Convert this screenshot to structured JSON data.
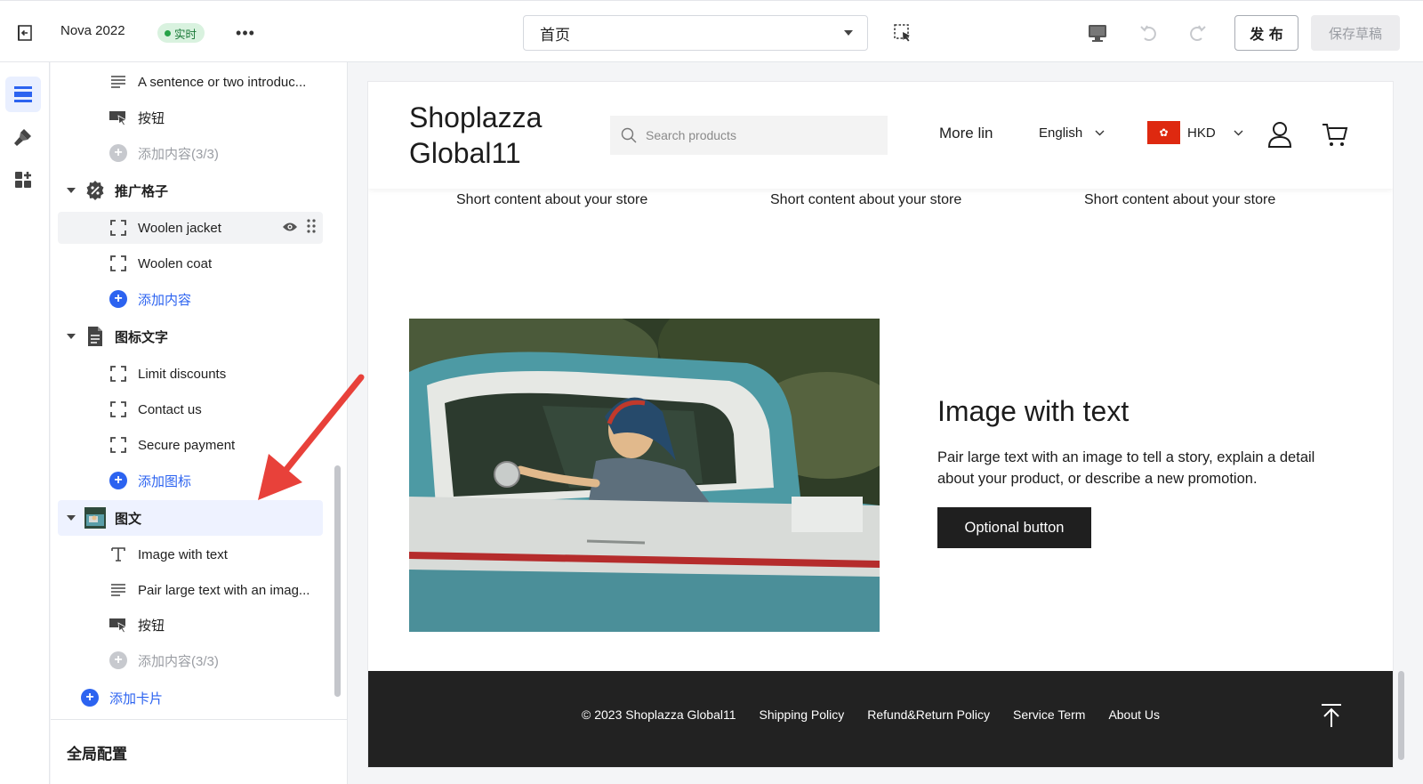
{
  "topbar": {
    "theme_name": "Nova 2022",
    "live_badge": "实时",
    "page_select": "首页",
    "publish": "发 布",
    "save_draft": "保存草稿"
  },
  "rail": {
    "items": [
      "sections-icon",
      "theme-style-icon",
      "apps-icon"
    ]
  },
  "sidebar": {
    "rows": {
      "r1": "A sentence or two introduc...",
      "r2": "按钮",
      "r3": "添加内容(3/3)",
      "g1": "推广格子",
      "r4": "Woolen jacket",
      "r5": "Woolen coat",
      "r6": "添加内容",
      "g2": "图标文字",
      "r7": "Limit discounts",
      "r8": "Contact us",
      "r9": "Secure payment",
      "r10": "添加图标",
      "g3": "图文",
      "r11": "Image with text",
      "r12": "Pair large text with an imag...",
      "r13": "按钮",
      "r14": "添加内容(3/3)",
      "r15": "添加卡片"
    },
    "global_settings": "全局配置"
  },
  "preview": {
    "logo": "Shoplazza Global11",
    "search_placeholder": "Search products",
    "nav_more": "More lin",
    "language": "English",
    "currency": "HKD",
    "short_content": [
      "Short content about your store",
      "Short content about your store",
      "Short content about your store"
    ],
    "section_title": "Image with text",
    "section_desc": "Pair large text with an image to tell a story, explain a detail about your product, or describe a new promotion.",
    "section_button": "Optional button",
    "footer": {
      "copyright": "© 2023 Shoplazza Global11",
      "links": [
        "Shipping Policy",
        "Refund&Return Policy",
        "Service Term",
        "About Us"
      ]
    }
  },
  "colors": {
    "accent": "#2c63f0",
    "live_green": "#27a348",
    "annotation_red": "#e8413a"
  }
}
